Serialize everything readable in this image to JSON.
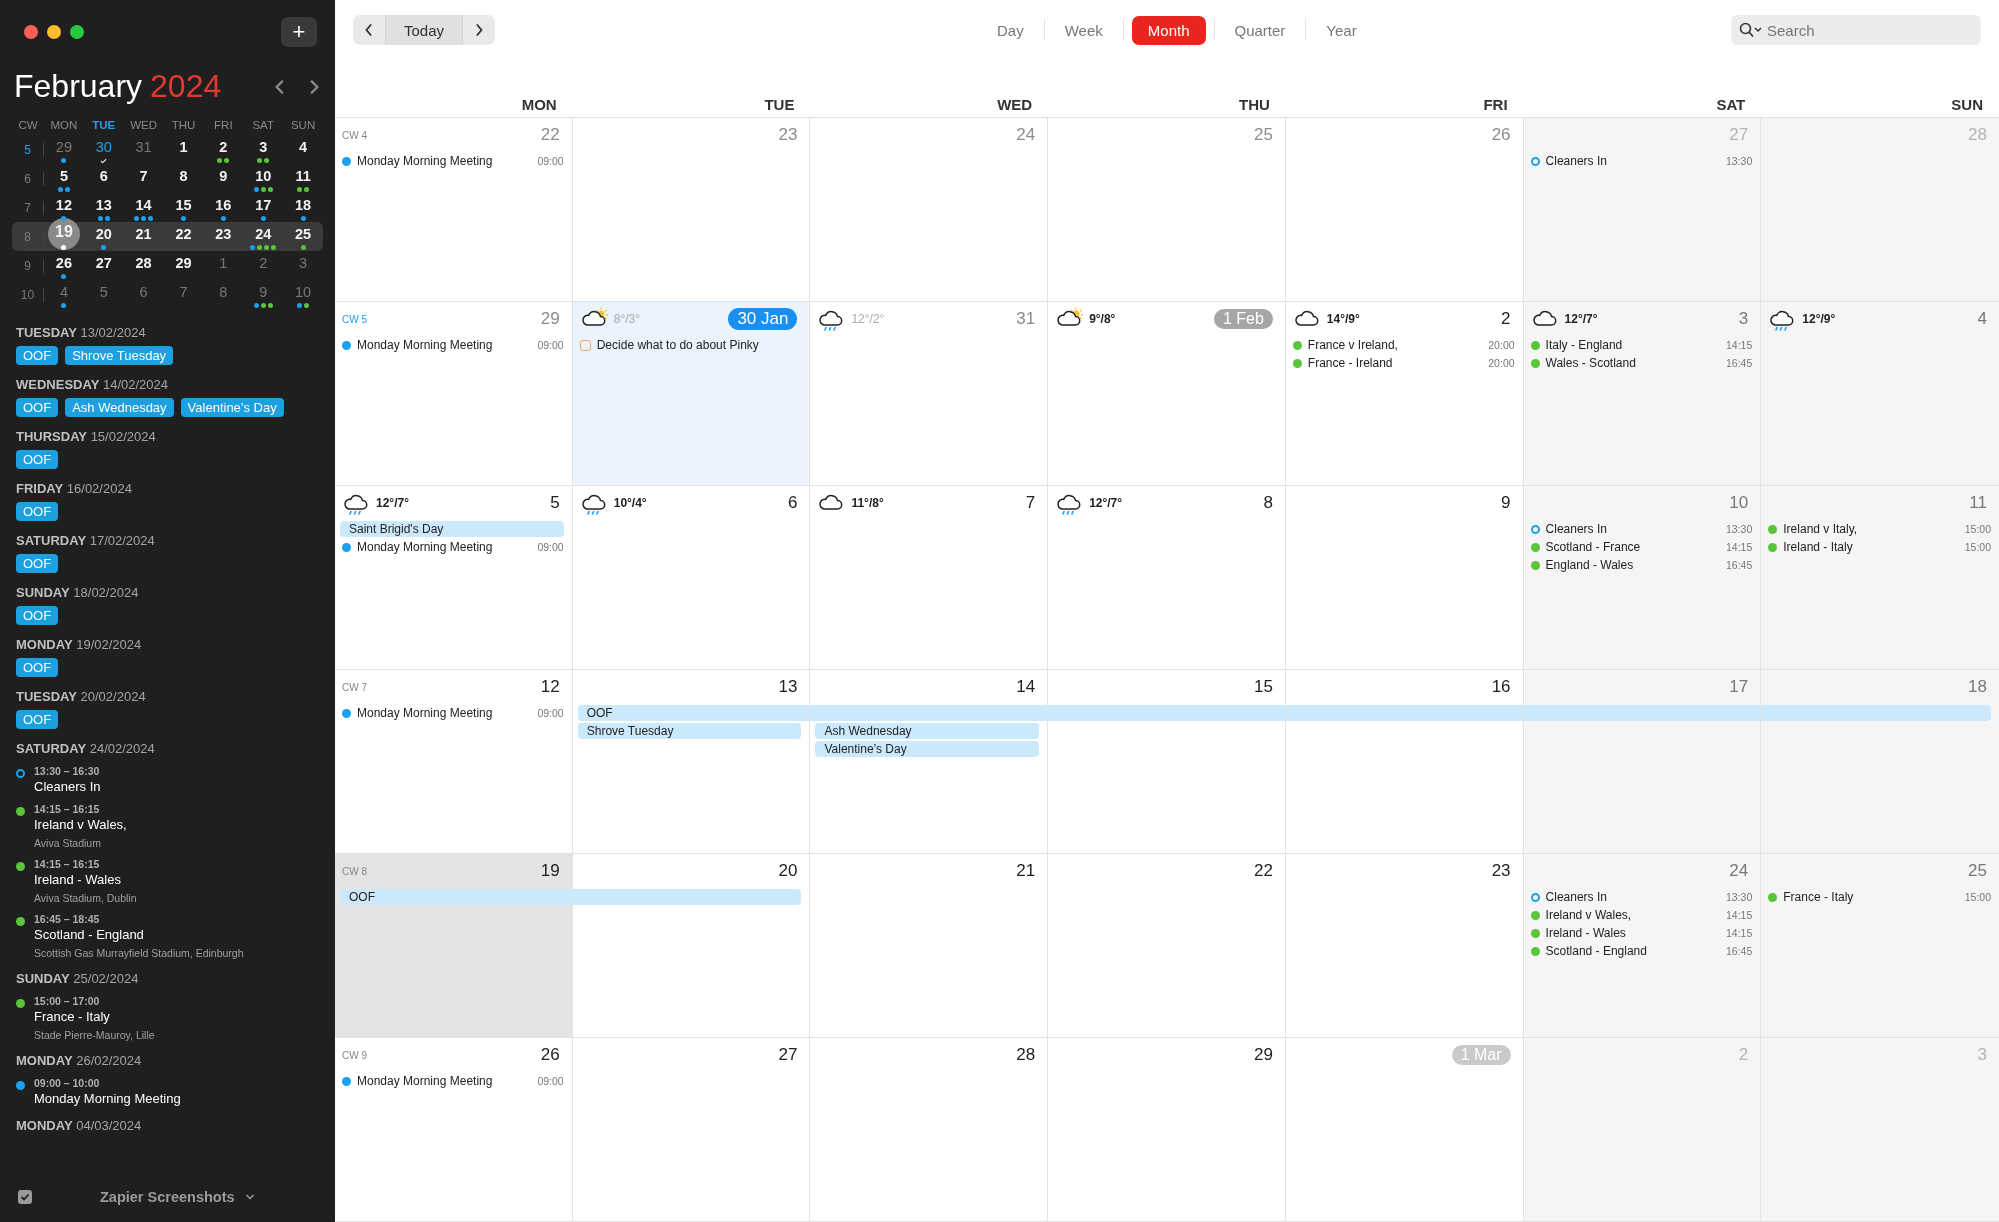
{
  "window": {
    "add_label": "+"
  },
  "sidebar": {
    "title": {
      "month": "February",
      "year": "2024"
    },
    "mini_calendar": {
      "headers": [
        {
          "label": "CW",
          "today": false
        },
        {
          "label": "MON",
          "today": false
        },
        {
          "label": "TUE",
          "today": true
        },
        {
          "label": "WED",
          "today": false
        },
        {
          "label": "THU",
          "today": false
        },
        {
          "label": "FRI",
          "today": false
        },
        {
          "label": "SAT",
          "today": false
        },
        {
          "label": "SUN",
          "today": false
        }
      ],
      "weeks": [
        {
          "cw": "5",
          "current": true,
          "selected": false,
          "days": [
            {
              "label": "29",
              "in_month": false,
              "today": false,
              "selected": false,
              "dots": [
                {
                  "color": "#1ca0f0"
                }
              ]
            },
            {
              "label": "30",
              "in_month": false,
              "today": true,
              "selected": false,
              "checkmark": true
            },
            {
              "label": "31",
              "in_month": false,
              "today": false,
              "selected": false
            },
            {
              "label": "1",
              "in_month": true,
              "today": false,
              "selected": false
            },
            {
              "label": "2",
              "in_month": true,
              "today": false,
              "selected": false,
              "dots": [
                {
                  "color": "#5ac43b"
                },
                {
                  "color": "#5ac43b"
                }
              ]
            },
            {
              "label": "3",
              "in_month": true,
              "today": false,
              "selected": false,
              "dots": [
                {
                  "color": "#5ac43b"
                },
                {
                  "color": "#5ac43b"
                }
              ]
            },
            {
              "label": "4",
              "in_month": true,
              "today": false,
              "selected": false
            }
          ]
        },
        {
          "cw": "6",
          "current": false,
          "selected": false,
          "days": [
            {
              "label": "5",
              "in_month": true,
              "today": false,
              "selected": false,
              "dots": [
                {
                  "color": "#1ca0f0"
                },
                {
                  "color": "#1ca0f0"
                }
              ]
            },
            {
              "label": "6",
              "in_month": true,
              "today": false,
              "selected": false
            },
            {
              "label": "7",
              "in_month": true,
              "today": false,
              "selected": false
            },
            {
              "label": "8",
              "in_month": true,
              "today": false,
              "selected": false
            },
            {
              "label": "9",
              "in_month": true,
              "today": false,
              "selected": false
            },
            {
              "label": "10",
              "in_month": true,
              "today": false,
              "selected": false,
              "dots": [
                {
                  "color": "#1ca0f0"
                },
                {
                  "color": "#5ac43b"
                },
                {
                  "color": "#5ac43b"
                }
              ]
            },
            {
              "label": "11",
              "in_month": true,
              "today": false,
              "selected": false,
              "dots": [
                {
                  "color": "#5ac43b"
                },
                {
                  "color": "#5ac43b"
                }
              ]
            }
          ]
        },
        {
          "cw": "7",
          "current": false,
          "selected": false,
          "days": [
            {
              "label": "12",
              "in_month": true,
              "today": false,
              "selected": false,
              "dots": [
                {
                  "color": "#1ca0f0"
                }
              ]
            },
            {
              "label": "13",
              "in_month": true,
              "today": false,
              "selected": false,
              "dots": [
                {
                  "color": "#1ca0f0"
                },
                {
                  "color": "#1ca0f0"
                }
              ]
            },
            {
              "label": "14",
              "in_month": true,
              "today": false,
              "selected": false,
              "dots": [
                {
                  "color": "#1ca0f0"
                },
                {
                  "color": "#1ca0f0"
                },
                {
                  "color": "#1ca0f0"
                }
              ]
            },
            {
              "label": "15",
              "in_month": true,
              "today": false,
              "selected": false,
              "dots": [
                {
                  "color": "#1ca0f0"
                }
              ]
            },
            {
              "label": "16",
              "in_month": true,
              "today": false,
              "selected": false,
              "dots": [
                {
                  "color": "#1ca0f0"
                }
              ]
            },
            {
              "label": "17",
              "in_month": true,
              "today": false,
              "selected": false,
              "dots": [
                {
                  "color": "#1ca0f0"
                }
              ]
            },
            {
              "label": "18",
              "in_month": true,
              "today": false,
              "selected": false,
              "dots": [
                {
                  "color": "#1ca0f0"
                }
              ]
            }
          ]
        },
        {
          "cw": "8",
          "current": false,
          "selected": true,
          "days": [
            {
              "label": "19",
              "in_month": true,
              "today": false,
              "selected": true,
              "dots": [
                {
                  "color": "#ffffff"
                }
              ]
            },
            {
              "label": "20",
              "in_month": true,
              "today": false,
              "selected": false,
              "dots": [
                {
                  "color": "#1ca0f0"
                }
              ]
            },
            {
              "label": "21",
              "in_month": true,
              "today": false,
              "selected": false
            },
            {
              "label": "22",
              "in_month": true,
              "today": false,
              "selected": false
            },
            {
              "label": "23",
              "in_month": true,
              "today": false,
              "selected": false
            },
            {
              "label": "24",
              "in_month": true,
              "today": false,
              "selected": false,
              "dots": [
                {
                  "color": "#1ca0f0"
                },
                {
                  "color": "#5ac43b"
                },
                {
                  "color": "#5ac43b"
                },
                {
                  "color": "#5ac43b"
                }
              ]
            },
            {
              "label": "25",
              "in_month": true,
              "today": false,
              "selected": false,
              "dots": [
                {
                  "color": "#5ac43b"
                }
              ]
            }
          ]
        },
        {
          "cw": "9",
          "current": false,
          "selected": false,
          "days": [
            {
              "label": "26",
              "in_month": true,
              "today": false,
              "selected": false,
              "dots": [
                {
                  "color": "#1ca0f0"
                }
              ]
            },
            {
              "label": "27",
              "in_month": true,
              "today": false,
              "selected": false
            },
            {
              "label": "28",
              "in_month": true,
              "today": false,
              "selected": false
            },
            {
              "label": "29",
              "in_month": true,
              "today": false,
              "selected": false
            },
            {
              "label": "1",
              "in_month": false,
              "today": false,
              "selected": false
            },
            {
              "label": "2",
              "in_month": false,
              "today": false,
              "selected": false
            },
            {
              "label": "3",
              "in_month": false,
              "today": false,
              "selected": false
            }
          ]
        },
        {
          "cw": "10",
          "current": false,
          "selected": false,
          "days": [
            {
              "label": "4",
              "in_month": false,
              "today": false,
              "selected": false,
              "dots": [
                {
                  "color": "#1ca0f0"
                }
              ]
            },
            {
              "label": "5",
              "in_month": false,
              "today": false,
              "selected": false
            },
            {
              "label": "6",
              "in_month": false,
              "today": false,
              "selected": false
            },
            {
              "label": "7",
              "in_month": false,
              "today": false,
              "selected": false
            },
            {
              "label": "8",
              "in_month": false,
              "today": false,
              "selected": false
            },
            {
              "label": "9",
              "in_month": false,
              "today": false,
              "selected": false,
              "dots": [
                {
                  "color": "#1ca0f0"
                },
                {
                  "color": "#5ac43b"
                },
                {
                  "color": "#5ac43b"
                }
              ]
            },
            {
              "label": "10",
              "in_month": false,
              "today": false,
              "selected": false,
              "dots": [
                {
                  "color": "#1ca0f0"
                },
                {
                  "color": "#5ac43b"
                }
              ]
            }
          ]
        }
      ]
    },
    "agenda": [
      {
        "heading": "**TUESDAY** 13/02/2024",
        "chips": [
          "OOF",
          "Shrove Tuesday"
        ]
      },
      {
        "heading": "**WEDNESDAY** 14/02/2024",
        "chips": [
          "OOF",
          "Ash Wednesday",
          "Valentine’s Day"
        ]
      },
      {
        "heading": "**THURSDAY** 15/02/2024",
        "chips": [
          "OOF"
        ]
      },
      {
        "heading": "**FRIDAY** 16/02/2024",
        "chips": [
          "OOF"
        ]
      },
      {
        "heading": "**SATURDAY** 17/02/2024",
        "chips": [
          "OOF"
        ]
      },
      {
        "heading": "**SUNDAY** 18/02/2024",
        "chips": [
          "OOF"
        ]
      },
      {
        "heading": "**MONDAY** 19/02/2024",
        "chips": [
          "OOF"
        ]
      },
      {
        "heading": "**TUESDAY** 20/02/2024",
        "chips": [
          "OOF"
        ]
      },
      {
        "heading": "**SATURDAY** 24/02/2024",
        "events": [
          {
            "time": "13:30 – 16:30",
            "title": "Cleaners In",
            "kind": "ring",
            "color": "#1ca0f0"
          },
          {
            "time": "14:15 – 16:15",
            "title": "Ireland v Wales,",
            "location": "Aviva Stadium",
            "kind": "dot",
            "color": "#5ac43b"
          },
          {
            "time": "14:15 – 16:15",
            "title": "Ireland - Wales",
            "location": "Aviva Stadium, Dublin",
            "kind": "dot",
            "color": "#5ac43b"
          },
          {
            "time": "16:45 – 18:45",
            "title": "Scotland - England",
            "location": "Scottish Gas Murrayfield Stadium, Edinburgh",
            "kind": "dot",
            "color": "#5ac43b"
          }
        ]
      },
      {
        "heading": "**SUNDAY** 25/02/2024",
        "events": [
          {
            "time": "15:00 – 17:00",
            "title": "France - Italy",
            "location": "Stade Pierre-Mauroy, Lille",
            "kind": "dot",
            "color": "#5ac43b"
          }
        ]
      },
      {
        "heading": "**MONDAY** 26/02/2024",
        "events": [
          {
            "time": "09:00 – 10:00",
            "title": "Monday Morning Meeting",
            "kind": "dot",
            "color": "#1ca0f0"
          }
        ]
      },
      {
        "heading": "**MONDAY** 04/03/2024"
      }
    ],
    "footer": {
      "checked": true,
      "label": "Zapier Screenshots"
    }
  },
  "toolbar": {
    "today_label": "Today",
    "views": [
      {
        "label": "Day",
        "selected": false
      },
      {
        "label": "Week",
        "selected": false
      },
      {
        "label": "Month",
        "selected": true
      },
      {
        "label": "Quarter",
        "selected": false
      },
      {
        "label": "Year",
        "selected": false
      }
    ],
    "search": {
      "placeholder": "Search"
    }
  },
  "columns": [
    "MON",
    "TUE",
    "WED",
    "THU",
    "FRI",
    "SAT",
    "SUN"
  ],
  "weeks": [
    {
      "cw": "CW 4",
      "current": false,
      "days": [
        {
          "date": "22",
          "in_month": false,
          "selected": false,
          "events": [
            {
              "title": "Monday Morning Meeting",
              "time": "09:00",
              "kind": "dot",
              "color": "#1ca0f0"
            }
          ]
        },
        {
          "date": "23",
          "in_month": false,
          "selected": false
        },
        {
          "date": "24",
          "in_month": false,
          "selected": false
        },
        {
          "date": "25",
          "in_month": false,
          "selected": false
        },
        {
          "date": "26",
          "in_month": false,
          "selected": false
        },
        {
          "date": "27",
          "in_month": false,
          "selected": false,
          "events": [
            {
              "title": "Cleaners In",
              "time": "13:30",
              "kind": "ring",
              "color": "#1ca0f0"
            }
          ]
        },
        {
          "date": "28",
          "in_month": false,
          "selected": false
        }
      ]
    },
    {
      "cw": "CW 5",
      "current": true,
      "days": [
        {
          "date": "29",
          "in_month": false,
          "selected": false,
          "events": [
            {
              "title": "Monday Morning Meeting",
              "time": "09:00",
              "kind": "dot",
              "color": "#1ca0f0"
            }
          ]
        },
        {
          "date": "30 Jan",
          "kind": "today",
          "in_month": false,
          "selected": false,
          "weather": {
            "temp": "8°/3°",
            "kind": "sun_cloud",
            "dimmed": true
          },
          "events": [
            {
              "title": "Decide what to do about Pinky",
              "kind": "square",
              "color": "#f4a261"
            }
          ]
        },
        {
          "date": "31",
          "in_month": false,
          "selected": false,
          "weather": {
            "temp": "12°/2°",
            "kind": "rain",
            "dimmed": true
          }
        },
        {
          "date": "1 Feb",
          "kind": "month_start",
          "in_month": true,
          "selected": false,
          "weather": {
            "temp": "9°/8°",
            "kind": "sun_cloud",
            "dimmed": false
          }
        },
        {
          "date": "2",
          "in_month": true,
          "selected": false,
          "weather": {
            "temp": "14°/9°",
            "kind": "cloud",
            "dimmed": false
          },
          "events": [
            {
              "title": "France v Ireland,",
              "time": "20:00",
              "kind": "dot",
              "color": "#5ac43b"
            },
            {
              "title": "France - Ireland",
              "time": "20:00",
              "kind": "dot",
              "color": "#5ac43b"
            }
          ]
        },
        {
          "date": "3",
          "in_month": true,
          "selected": false,
          "weather": {
            "temp": "12°/7°",
            "kind": "cloud",
            "dimmed": false
          },
          "events": [
            {
              "title": "Italy - England",
              "time": "14:15",
              "kind": "dot",
              "color": "#5ac43b"
            },
            {
              "title": "Wales - Scotland",
              "time": "16:45",
              "kind": "dot",
              "color": "#5ac43b"
            }
          ]
        },
        {
          "date": "4",
          "in_month": true,
          "selected": false,
          "weather": {
            "temp": "12°/9°",
            "kind": "rain",
            "dimmed": false
          }
        }
      ]
    },
    {
      "days": [
        {
          "date": "5",
          "in_month": true,
          "selected": false,
          "weather": {
            "temp": "12°/7°",
            "kind": "rain",
            "dimmed": false
          },
          "all_day": [
            {
              "kind": "event",
              "label": "Saint Brigid's Day"
            }
          ],
          "events": [
            {
              "title": "Monday Morning Meeting",
              "time": "09:00",
              "kind": "dot",
              "color": "#1ca0f0"
            }
          ]
        },
        {
          "date": "6",
          "in_month": true,
          "selected": false,
          "weather": {
            "temp": "10°/4°",
            "kind": "rain",
            "dimmed": false
          }
        },
        {
          "date": "7",
          "in_month": true,
          "selected": false,
          "weather": {
            "temp": "11°/8°",
            "kind": "cloud",
            "dimmed": false
          }
        },
        {
          "date": "8",
          "in_month": true,
          "selected": false,
          "weather": {
            "temp": "12°/7°",
            "kind": "rain",
            "dimmed": false
          }
        },
        {
          "date": "9",
          "in_month": true,
          "selected": false
        },
        {
          "date": "10",
          "in_month": true,
          "selected": false,
          "events": [
            {
              "title": "Cleaners In",
              "time": "13:30",
              "kind": "ring",
              "color": "#1ca0f0"
            },
            {
              "title": "Scotland - France",
              "time": "14:15",
              "kind": "dot",
              "color": "#5ac43b"
            },
            {
              "title": "England - Wales",
              "time": "16:45",
              "kind": "dot",
              "color": "#5ac43b"
            }
          ]
        },
        {
          "date": "11",
          "in_month": true,
          "selected": false,
          "events": [
            {
              "title": "Ireland v Italy,",
              "time": "15:00",
              "kind": "dot",
              "color": "#5ac43b"
            },
            {
              "title": "Ireland - Italy",
              "time": "15:00",
              "kind": "dot",
              "color": "#5ac43b"
            }
          ]
        }
      ]
    },
    {
      "cw": "CW 7",
      "current": false,
      "days": [
        {
          "date": "12",
          "in_month": true,
          "selected": false,
          "events": [
            {
              "title": "Monday Morning Meeting",
              "time": "09:00",
              "kind": "dot",
              "color": "#1ca0f0"
            }
          ]
        },
        {
          "date": "13",
          "in_month": true,
          "selected": false,
          "all_day": [
            {
              "kind": "event",
              "label": "OOF"
            },
            {
              "kind": "event",
              "label": "Shrove Tuesday"
            }
          ]
        },
        {
          "date": "14",
          "in_month": true,
          "selected": false,
          "all_day": [
            {
              "kind": "continuation"
            },
            {
              "kind": "event",
              "label": "Ash Wednesday"
            },
            {
              "kind": "event",
              "label": "Valentine’s Day"
            }
          ]
        },
        {
          "date": "15",
          "in_month": true,
          "selected": false,
          "all_day": [
            {
              "kind": "continuation"
            }
          ]
        },
        {
          "date": "16",
          "in_month": true,
          "selected": false,
          "all_day": [
            {
              "kind": "continuation"
            }
          ]
        },
        {
          "date": "17",
          "in_month": true,
          "selected": false,
          "all_day": [
            {
              "kind": "continuation"
            }
          ]
        },
        {
          "date": "18",
          "in_month": true,
          "selected": false,
          "all_day": [
            {
              "kind": "continuation"
            }
          ]
        }
      ]
    },
    {
      "cw": "CW 8",
      "current": false,
      "days": [
        {
          "date": "19",
          "in_month": true,
          "selected": true,
          "all_day": [
            {
              "kind": "event",
              "label": "OOF"
            }
          ]
        },
        {
          "date": "20",
          "in_month": true,
          "selected": false,
          "all_day": [
            {
              "kind": "continuation"
            }
          ]
        },
        {
          "date": "21",
          "in_month": true,
          "selected": false
        },
        {
          "date": "22",
          "in_month": true,
          "selected": false
        },
        {
          "date": "23",
          "in_month": true,
          "selected": false
        },
        {
          "date": "24",
          "in_month": true,
          "selected": false,
          "events": [
            {
              "title": "Cleaners In",
              "time": "13:30",
              "kind": "ring",
              "color": "#1ca0f0"
            },
            {
              "title": "Ireland v Wales,",
              "time": "14:15",
              "kind": "dot",
              "color": "#5ac43b"
            },
            {
              "title": "Ireland - Wales",
              "time": "14:15",
              "kind": "dot",
              "color": "#5ac43b"
            },
            {
              "title": "Scotland - England",
              "time": "16:45",
              "kind": "dot",
              "color": "#5ac43b"
            }
          ]
        },
        {
          "date": "25",
          "in_month": true,
          "selected": false,
          "events": [
            {
              "title": "France - Italy",
              "time": "15:00",
              "kind": "dot",
              "color": "#5ac43b"
            }
          ]
        }
      ]
    },
    {
      "cw": "CW 9",
      "current": false,
      "days": [
        {
          "date": "26",
          "in_month": true,
          "selected": false,
          "events": [
            {
              "title": "Monday Morning Meeting",
              "time": "09:00",
              "kind": "dot",
              "color": "#1ca0f0"
            }
          ]
        },
        {
          "date": "27",
          "in_month": true,
          "selected": false
        },
        {
          "date": "28",
          "in_month": true,
          "selected": false
        },
        {
          "date": "29",
          "in_month": true,
          "selected": false
        },
        {
          "date": "1 Mar",
          "kind": "month_start",
          "in_month": false,
          "selected": false
        },
        {
          "date": "2",
          "in_month": false,
          "selected": false
        },
        {
          "date": "3",
          "in_month": false,
          "selected": false
        }
      ]
    }
  ]
}
